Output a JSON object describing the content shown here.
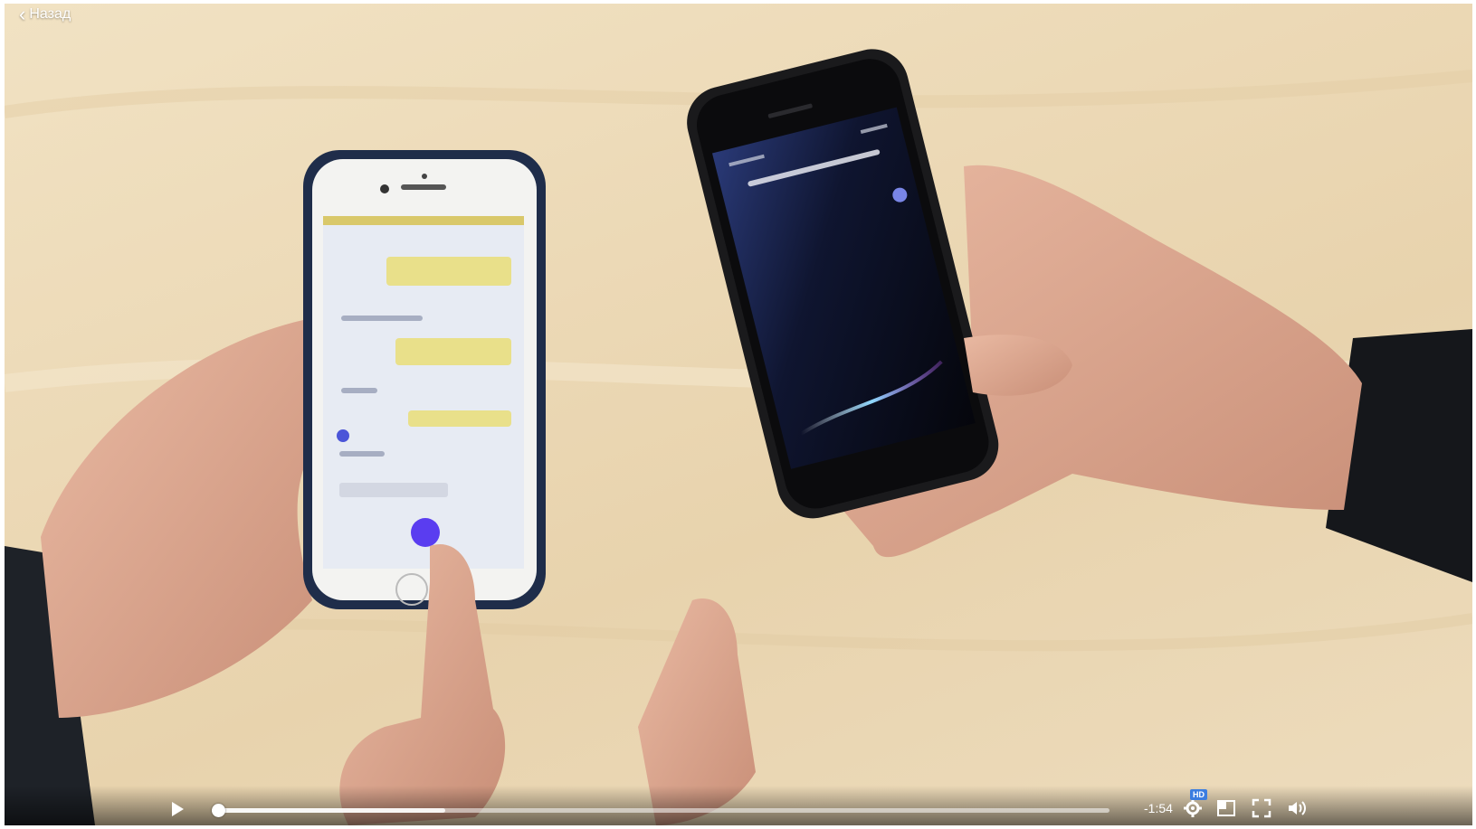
{
  "player": {
    "back_label": "Назад",
    "time_remaining": "-1:54",
    "quality_badge": "HD",
    "progress_fraction": 0.007,
    "buffered_fraction": 0.26
  },
  "icons": {
    "back": "chevron-left-icon",
    "play": "play-icon",
    "settings": "gear-icon",
    "pip": "picture-in-picture-icon",
    "fullscreen": "fullscreen-icon",
    "volume": "volume-icon"
  }
}
